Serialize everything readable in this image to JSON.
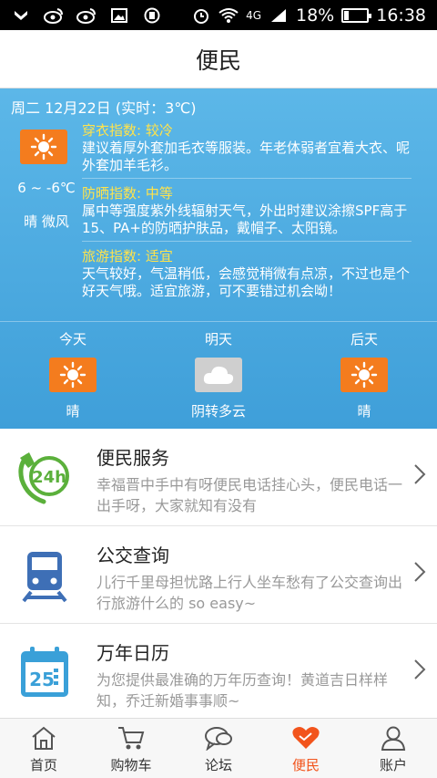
{
  "status_bar": {
    "network": "4G",
    "battery": "18%",
    "battery_level": 0.18,
    "time": "16:38"
  },
  "title": "便民",
  "weather": {
    "date_line": "周二 12月22日 (实时：3℃)",
    "temp_range": "6 ~ -6℃",
    "condition": "晴 微风",
    "indices": [
      {
        "title": "穿衣指数: 较冷",
        "text": "建议着厚外套加毛衣等服装。年老体弱者宜着大衣、呢外套加羊毛衫。"
      },
      {
        "title": "防晒指数: 中等",
        "text": "属中等强度紫外线辐射天气，外出时建议涂擦SPF高于15、PA+的防晒护肤品，戴帽子、太阳镜。"
      },
      {
        "title": "旅游指数: 适宜",
        "text": "天气较好，气温稍低，会感觉稍微有点凉，不过也是个好天气哦。适宜旅游，可不要错过机会呦！"
      }
    ],
    "forecast": [
      {
        "day": "今天",
        "desc": "晴",
        "icon": "sun-icon"
      },
      {
        "day": "明天",
        "desc": "阴转多云",
        "icon": "cloud-icon"
      },
      {
        "day": "后天",
        "desc": "晴",
        "icon": "sun-icon"
      }
    ]
  },
  "services": [
    {
      "title": "便民服务",
      "desc": "幸福晋中手中有呀便民电话挂心头，便民电话一出手呀，大家就知有没有",
      "icon": "phone-24h-icon"
    },
    {
      "title": "公交查询",
      "desc": "儿行千里母担忧路上行人坐车愁有了公交查询出行旅游什么的 so easy~",
      "icon": "train-icon"
    },
    {
      "title": "万年日历",
      "desc": "为您提供最准确的万年历查询！黄道吉日样样知，乔迁新婚事事顺~",
      "icon": "calendar-icon"
    }
  ],
  "tabs": [
    {
      "label": "首页",
      "icon": "home-icon"
    },
    {
      "label": "购物车",
      "icon": "cart-icon"
    },
    {
      "label": "论坛",
      "icon": "chat-icon"
    },
    {
      "label": "便民",
      "icon": "handshake-icon",
      "active": true
    },
    {
      "label": "账户",
      "icon": "user-icon"
    }
  ],
  "colors": {
    "accent": "#f2541c",
    "weather_bg": "#4aa9df",
    "index_title": "#ffe34b",
    "sun_bg": "#f47c1e"
  }
}
